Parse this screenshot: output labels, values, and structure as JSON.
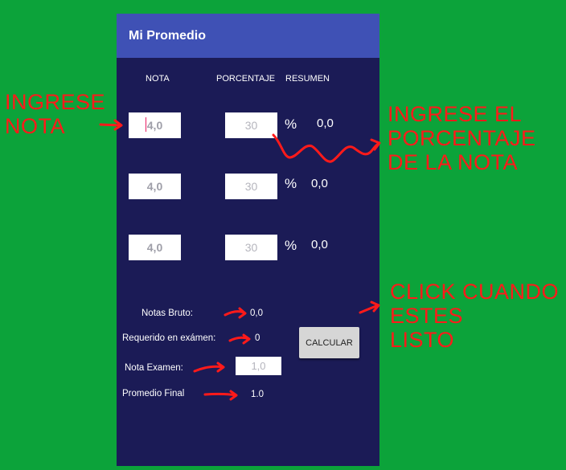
{
  "app": {
    "title": "Mi Promedio"
  },
  "headers": {
    "nota": "NOTA",
    "porcentaje": "PORCENTAJE",
    "resumen": "RESUMEN"
  },
  "rows": [
    {
      "nota": "4,0",
      "porcentaje": "30",
      "percent_sign": "%",
      "resumen": "0,0"
    },
    {
      "nota": "4,0",
      "porcentaje": "30",
      "percent_sign": "%",
      "resumen": "0,0"
    },
    {
      "nota": "4,0",
      "porcentaje": "30",
      "percent_sign": "%",
      "resumen": "0,0"
    }
  ],
  "summary": {
    "notas_bruto_label": "Notas Bruto:",
    "notas_bruto_value": "0,0",
    "requerido_label": "Requerido en exámen:",
    "requerido_value": "0",
    "nota_examen_label": "Nota Examen:",
    "nota_examen_placeholder": "1,0",
    "promedio_label": "Promedio Final",
    "promedio_value": "1.0"
  },
  "calcular_label": "CALCULAR",
  "annotations": {
    "ingrese_nota": [
      "INGRESE",
      "NOTA"
    ],
    "ingrese_porcentaje": [
      "INGRESE EL",
      "PORCENTAJE",
      "DE LA NOTA"
    ],
    "click_cuando": [
      "CLICK CUANDO",
      "ESTES",
      "LISTO"
    ]
  },
  "colors": {
    "background": "#0ca33a",
    "app_bar": "#3f51b5",
    "screen": "#1b1b56",
    "annotation": "#ff1a1a"
  }
}
